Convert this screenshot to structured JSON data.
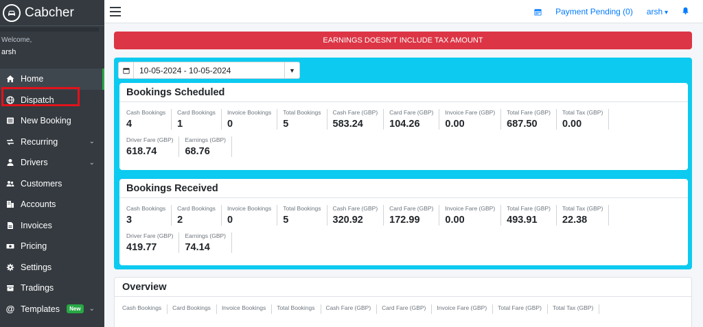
{
  "brand": {
    "name": "Cabcher"
  },
  "user": {
    "welcome": "Welcome,",
    "name": "arsh"
  },
  "sidebar": {
    "items": [
      {
        "label": "Home",
        "icon": "home-icon",
        "expandable": false,
        "active": true
      },
      {
        "label": "Dispatch",
        "icon": "globe-icon",
        "expandable": false,
        "highlighted": true
      },
      {
        "label": "New Booking",
        "icon": "list-icon",
        "expandable": false
      },
      {
        "label": "Recurring",
        "icon": "recurring-icon",
        "expandable": true
      },
      {
        "label": "Drivers",
        "icon": "user-icon",
        "expandable": true
      },
      {
        "label": "Customers",
        "icon": "users-icon",
        "expandable": false
      },
      {
        "label": "Accounts",
        "icon": "building-icon",
        "expandable": false
      },
      {
        "label": "Invoices",
        "icon": "file-icon",
        "expandable": false
      },
      {
        "label": "Pricing",
        "icon": "money-icon",
        "expandable": false
      },
      {
        "label": "Settings",
        "icon": "gear-icon",
        "expandable": false
      },
      {
        "label": "Tradings",
        "icon": "tradings-icon",
        "expandable": false
      },
      {
        "label": "Templates",
        "icon": "at-icon",
        "expandable": true,
        "badge": "New"
      }
    ]
  },
  "topbar": {
    "payment_pending": "Payment Pending (0)",
    "user": "arsh"
  },
  "alert": {
    "text": "EARNINGS DOESN'T INCLUDE TAX AMOUNT"
  },
  "date_range": {
    "value": "10-05-2024 - 10-05-2024"
  },
  "scheduled": {
    "title": "Bookings Scheduled",
    "stats": [
      {
        "label": "Cash Bookings",
        "value": "4"
      },
      {
        "label": "Card Bookings",
        "value": "1"
      },
      {
        "label": "Invoice Bookings",
        "value": "0"
      },
      {
        "label": "Total Bookings",
        "value": "5"
      },
      {
        "label": "Cash Fare (GBP)",
        "value": "583.24"
      },
      {
        "label": "Card Fare (GBP)",
        "value": "104.26"
      },
      {
        "label": "Invoice Fare (GBP)",
        "value": "0.00"
      },
      {
        "label": "Total Fare (GBP)",
        "value": "687.50"
      },
      {
        "label": "Total Tax (GBP)",
        "value": "0.00"
      },
      {
        "label": "Driver Fare (GBP)",
        "value": "618.74"
      },
      {
        "label": "Earnings (GBP)",
        "value": "68.76"
      }
    ]
  },
  "received": {
    "title": "Bookings Received",
    "stats": [
      {
        "label": "Cash Bookings",
        "value": "3"
      },
      {
        "label": "Card Bookings",
        "value": "2"
      },
      {
        "label": "Invoice Bookings",
        "value": "0"
      },
      {
        "label": "Total Bookings",
        "value": "5"
      },
      {
        "label": "Cash Fare (GBP)",
        "value": "320.92"
      },
      {
        "label": "Card Fare (GBP)",
        "value": "172.99"
      },
      {
        "label": "Invoice Fare (GBP)",
        "value": "0.00"
      },
      {
        "label": "Total Fare (GBP)",
        "value": "493.91"
      },
      {
        "label": "Total Tax (GBP)",
        "value": "22.38"
      },
      {
        "label": "Driver Fare (GBP)",
        "value": "419.77"
      },
      {
        "label": "Earnings (GBP)",
        "value": "74.14"
      }
    ]
  },
  "overview": {
    "title": "Overview",
    "labels": [
      "Cash Bookings",
      "Card Bookings",
      "Invoice Bookings",
      "Total Bookings",
      "Cash Fare (GBP)",
      "Card Fare (GBP)",
      "Invoice Fare (GBP)",
      "Total Fare (GBP)",
      "Total Tax (GBP)"
    ]
  },
  "colors": {
    "sidebar": "#343a40",
    "accent": "#0dcaf0",
    "alert": "#dc3545",
    "link": "#007bff",
    "badge": "#28a745",
    "highlight_box": "#e3121b"
  }
}
